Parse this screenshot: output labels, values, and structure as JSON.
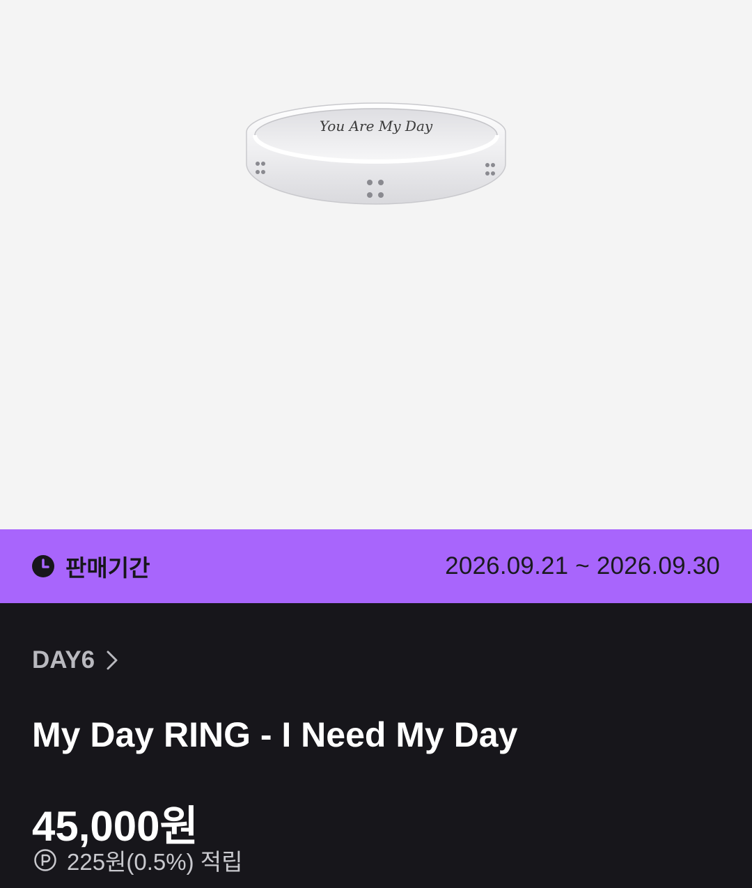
{
  "product": {
    "image_engraving": "You Are My Day",
    "sale_period": {
      "label": "판매기간",
      "dates": "2026.09.21 ~ 2026.09.30"
    },
    "artist": "DAY6",
    "title": "My Day RING - I Need My Day",
    "price": "45,000원",
    "points": "225원(0.5%) 적립"
  },
  "colors": {
    "accent": "#a865fc",
    "background_dark": "#17161b",
    "image_background": "#f4f4f4"
  },
  "icons": {
    "sale_period": "clock-icon",
    "artist_link": "chevron-right-icon",
    "points": "point-p-icon"
  }
}
